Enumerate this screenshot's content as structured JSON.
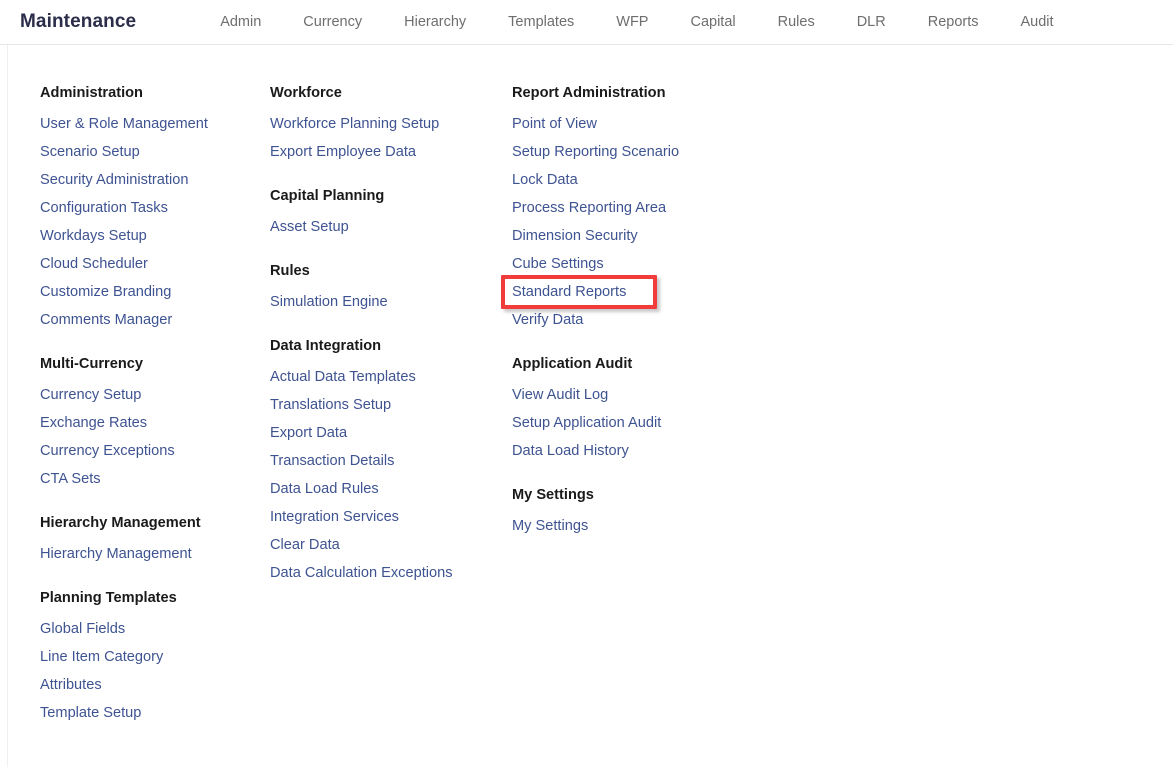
{
  "header": {
    "app_title": "Maintenance",
    "nav_items": [
      {
        "label": "Admin"
      },
      {
        "label": "Currency"
      },
      {
        "label": "Hierarchy"
      },
      {
        "label": "Templates"
      },
      {
        "label": "WFP"
      },
      {
        "label": "Capital"
      },
      {
        "label": "Rules"
      },
      {
        "label": "DLR"
      },
      {
        "label": "Reports"
      },
      {
        "label": "Audit"
      }
    ]
  },
  "columns": [
    {
      "name": "column-1",
      "groups": [
        {
          "title": "Administration",
          "links": [
            {
              "label": "User & Role Management"
            },
            {
              "label": "Scenario Setup"
            },
            {
              "label": "Security Administration"
            },
            {
              "label": "Configuration Tasks"
            },
            {
              "label": "Workdays Setup"
            },
            {
              "label": "Cloud Scheduler"
            },
            {
              "label": "Customize Branding"
            },
            {
              "label": "Comments Manager"
            }
          ]
        },
        {
          "title": "Multi-Currency",
          "links": [
            {
              "label": "Currency Setup"
            },
            {
              "label": "Exchange Rates"
            },
            {
              "label": "Currency Exceptions"
            },
            {
              "label": "CTA Sets"
            }
          ]
        },
        {
          "title": "Hierarchy Management",
          "links": [
            {
              "label": "Hierarchy Management"
            }
          ]
        },
        {
          "title": "Planning Templates",
          "links": [
            {
              "label": "Global Fields"
            },
            {
              "label": "Line Item Category"
            },
            {
              "label": "Attributes"
            },
            {
              "label": "Template Setup"
            }
          ]
        }
      ]
    },
    {
      "name": "column-2",
      "groups": [
        {
          "title": "Workforce",
          "links": [
            {
              "label": "Workforce Planning Setup"
            },
            {
              "label": "Export Employee Data"
            }
          ]
        },
        {
          "title": "Capital Planning",
          "links": [
            {
              "label": "Asset Setup"
            }
          ]
        },
        {
          "title": "Rules",
          "links": [
            {
              "label": "Simulation Engine"
            }
          ]
        },
        {
          "title": "Data Integration",
          "links": [
            {
              "label": "Actual Data Templates"
            },
            {
              "label": "Translations Setup"
            },
            {
              "label": "Export Data"
            },
            {
              "label": "Transaction Details"
            },
            {
              "label": "Data Load Rules"
            },
            {
              "label": "Integration Services"
            },
            {
              "label": "Clear Data"
            },
            {
              "label": "Data Calculation Exceptions"
            }
          ]
        }
      ]
    },
    {
      "name": "column-3",
      "groups": [
        {
          "title": "Report Administration",
          "links": [
            {
              "label": "Point of View"
            },
            {
              "label": "Setup Reporting Scenario"
            },
            {
              "label": "Lock Data"
            },
            {
              "label": "Process Reporting Area"
            },
            {
              "label": "Dimension Security"
            },
            {
              "label": "Cube Settings"
            },
            {
              "label": "Standard Reports",
              "highlighted": true
            },
            {
              "label": "Verify Data"
            }
          ]
        },
        {
          "title": "Application Audit",
          "links": [
            {
              "label": "View Audit Log"
            },
            {
              "label": "Setup Application Audit"
            },
            {
              "label": "Data Load History"
            }
          ]
        },
        {
          "title": "My Settings",
          "links": [
            {
              "label": "My Settings"
            }
          ]
        }
      ]
    }
  ],
  "annotation": {
    "highlight_color": "#f23b3b",
    "target_label": "Standard Reports"
  },
  "theme": {
    "link_color": "#3e5391",
    "heading_color": "#1a1a1a",
    "nav_color": "#6e6e6e",
    "title_color": "#2b2e4a",
    "background": "#ffffff"
  }
}
